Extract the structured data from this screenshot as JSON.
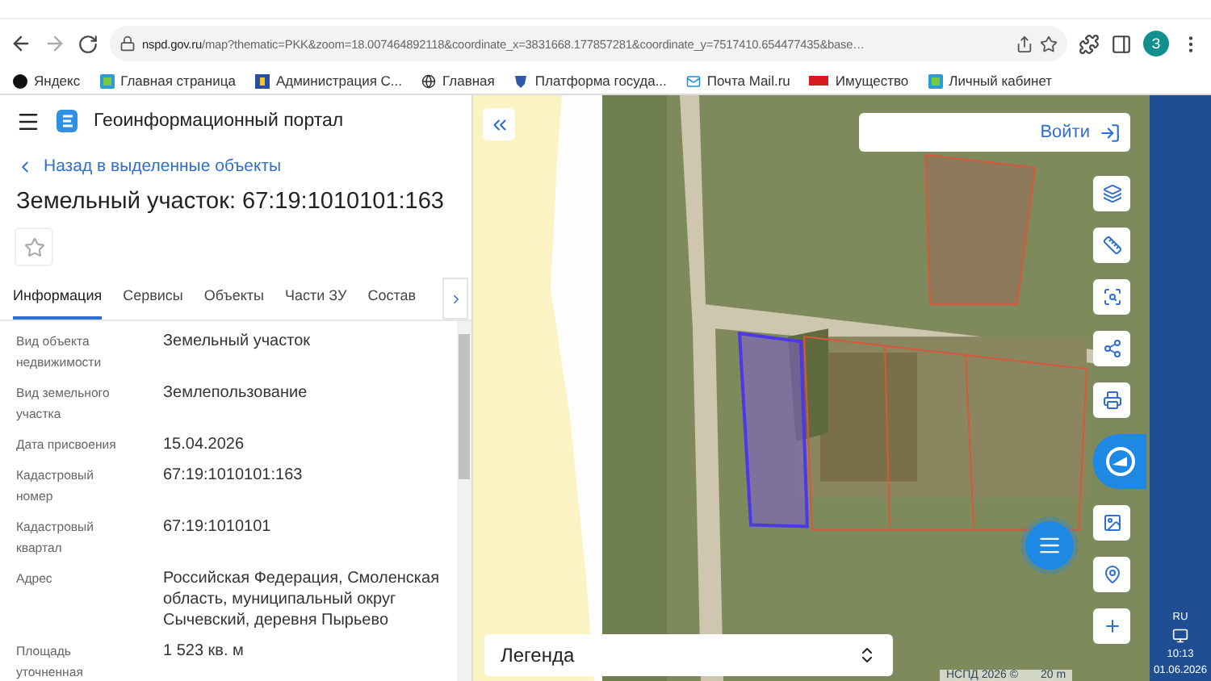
{
  "browser": {
    "host": "nspd.gov.ru",
    "path": "/map?thematic=PKK&zoom=18.007464892118&coordinate_x=3831668.177857281&coordinate_y=7517410.654477435&base…",
    "profile": "З",
    "bookmarks": [
      {
        "label": "Яндекс",
        "kind": "yandex"
      },
      {
        "label": "Главная страница",
        "kind": "site"
      },
      {
        "label": "Администрация С...",
        "kind": "crest"
      },
      {
        "label": "Главная",
        "kind": "globe"
      },
      {
        "label": "Платформа госуда...",
        "kind": "emblem"
      },
      {
        "label": "Почта Mail.ru",
        "kind": "mail"
      },
      {
        "label": "Имущество",
        "kind": "rgs"
      },
      {
        "label": "Личный кабинет",
        "kind": "site"
      }
    ]
  },
  "app": {
    "title": "Геоинформационный портал"
  },
  "back_link": "Назад в выделенные объекты",
  "heading": "Земельный участок: 67:19:1010101:163",
  "favorite": {
    "checked": false
  },
  "tabs": [
    {
      "label": "Информация",
      "selected": true
    },
    {
      "label": "Сервисы",
      "selected": false
    },
    {
      "label": "Объекты",
      "selected": false
    },
    {
      "label": "Части ЗУ",
      "selected": false
    },
    {
      "label": "Состав",
      "selected": false
    }
  ],
  "fields": [
    {
      "label": "Вид объекта недвижимости",
      "value": "Земельный участок"
    },
    {
      "label": "Вид земельного участка",
      "value": "Землепользование"
    },
    {
      "label": "Дата присвоения",
      "value": "15.04.2026"
    },
    {
      "label": "Кадастровый номер",
      "value": "67:19:1010101:163"
    },
    {
      "label": "Кадастровый квартал",
      "value": "67:19:1010101"
    },
    {
      "label": "Адрес",
      "value": "Российская Федерация, Смоленская область, муниципальный округ Сычевский, деревня Пырьево"
    },
    {
      "label": "Площадь уточненная",
      "value": "1 523 кв. м"
    }
  ],
  "map": {
    "login": "Войти",
    "legend": "Легенда",
    "attribution": "НСПД 2026 ©",
    "scale": "20 m",
    "tools": [
      {
        "kind": "layers"
      },
      {
        "kind": "ruler"
      },
      {
        "kind": "select"
      },
      {
        "kind": "share"
      },
      {
        "kind": "print"
      },
      {
        "kind": "assistant"
      },
      {
        "kind": "basemap"
      },
      {
        "kind": "locate"
      },
      {
        "kind": "zoom-in"
      }
    ]
  },
  "taskbar": {
    "language": "RU",
    "time": "10:13",
    "date": "01.06.2026"
  }
}
